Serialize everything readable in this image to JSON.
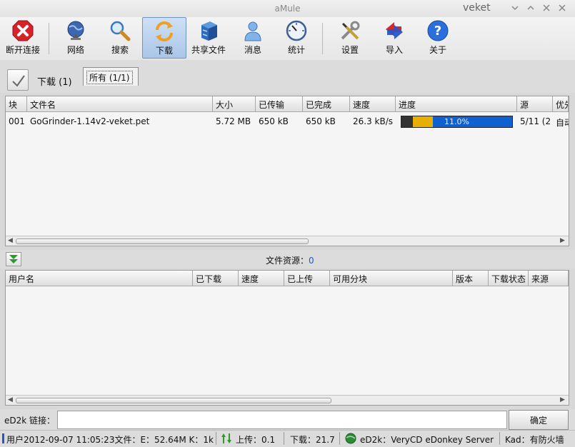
{
  "window": {
    "title": "aMule",
    "user": "veket",
    "min": "⌄",
    "restore": "⌃",
    "maximize": "✕",
    "close": "✕"
  },
  "toolbar": {
    "items": [
      {
        "label": "断开连接",
        "icon": "disconnect-icon"
      },
      {
        "label": "网络",
        "icon": "network-globe-icon"
      },
      {
        "label": "搜索",
        "icon": "search-magnifier-icon"
      },
      {
        "label": "下载",
        "icon": "download-arrows-icon",
        "active": true
      },
      {
        "label": "共享文件",
        "icon": "shared-files-cabinet-icon"
      },
      {
        "label": "消息",
        "icon": "messages-person-icon"
      },
      {
        "label": "统计",
        "icon": "statistics-gauge-icon"
      },
      {
        "label": "设置",
        "icon": "settings-tools-icon"
      },
      {
        "label": "导入",
        "icon": "import-arrows-icon"
      },
      {
        "label": "关于",
        "icon": "about-question-icon"
      }
    ]
  },
  "tabs": {
    "downloads_label": "下载 (1)",
    "all_tab": "所有 (1/1)"
  },
  "downloads": {
    "columns": [
      "块",
      "文件名",
      "大小",
      "已传输",
      "已完成",
      "速度",
      "进度",
      "源",
      "优先"
    ],
    "rows": [
      {
        "part": "001",
        "filename": "GoGrinder-1.14v2-veket.pet",
        "size": "5.72 MB",
        "transferred": "650 kB",
        "completed": "650 kB",
        "speed": "26.3 kB/s",
        "progress": "11.0%",
        "progress_fraction": 0.11,
        "sources": "5/11 (2",
        "priority": "自动"
      }
    ]
  },
  "sources_bar": {
    "label": "文件资源：",
    "count": "0"
  },
  "sources": {
    "columns": [
      "用户名",
      "已下载",
      "速度",
      "已上传",
      "可用分块",
      "版本",
      "下载状态",
      "来源"
    ]
  },
  "ed2k": {
    "label": "eD2k 链接：",
    "value": "",
    "ok_button": "确定"
  },
  "statusbar": {
    "log": "用户2012-09-07 11:05:23文件：E：52.64M K：1k",
    "upload": "上传：0.1",
    "download": "下载：21.7",
    "server": "eD2k：VeryCD eDonkey Server",
    "kad": "Kad：有防火墙"
  },
  "colors": {
    "accent": "#1060d0",
    "progress_done": "#e7b000",
    "active_tab": "#a9c6e8"
  }
}
